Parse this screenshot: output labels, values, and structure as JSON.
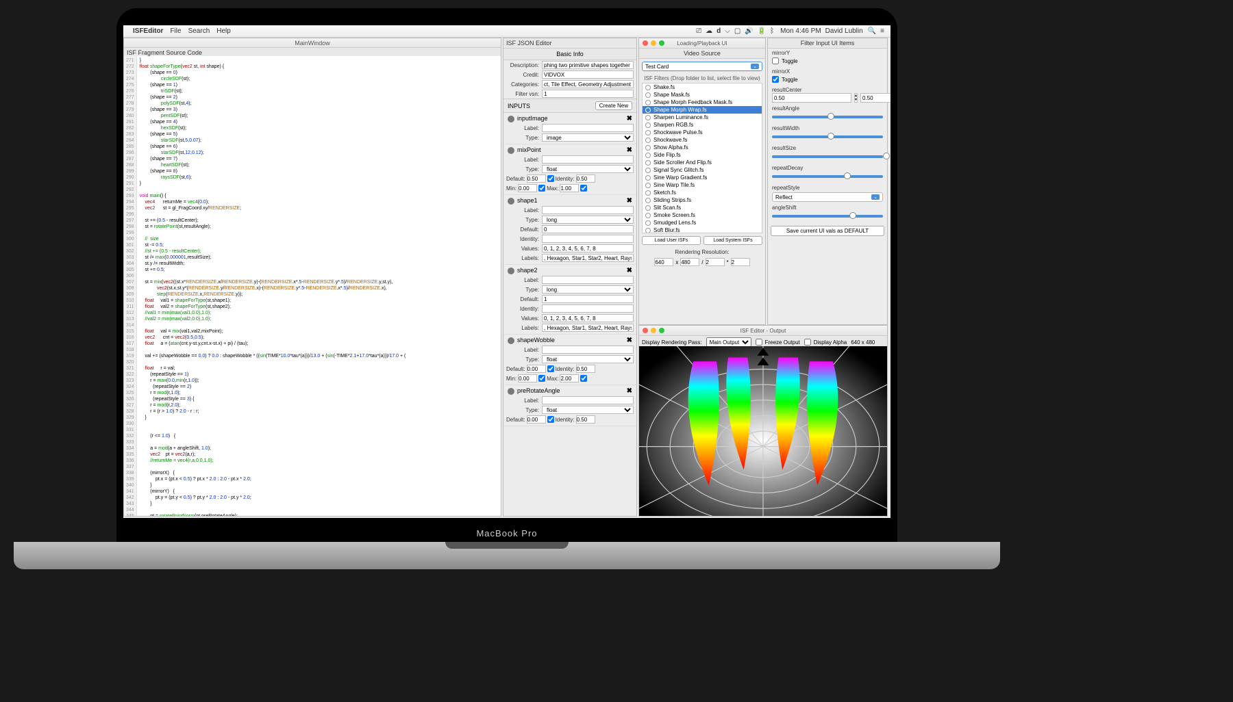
{
  "menubar": {
    "app": "ISFEditor",
    "menus": [
      "File",
      "Search",
      "Help"
    ],
    "clock": "Mon 4:46 PM",
    "user": "David Lublin"
  },
  "main_window": {
    "title": "MainWindow",
    "fragment_header": "ISF Fragment Source Code",
    "code_first_line": 271
  },
  "json_editor": {
    "title": "ISF JSON Editor",
    "basic_info": "Basic Info",
    "description_label": "Description:",
    "description_value": "phing two primitive shapes together",
    "credit_label": "Credit:",
    "credit_value": "VIDVOX",
    "categories_label": "Categories:",
    "categories_value": "ct, Tile Effect, Geometry Adjustment",
    "filter_vsn_label": "Filter vsn:",
    "filter_vsn_value": "1",
    "inputs_label": "INPUTS",
    "create_new": "Create New",
    "inputs": [
      {
        "name": "inputImage",
        "type": "image",
        "label": ""
      },
      {
        "name": "mixPoint",
        "type": "float",
        "label": "",
        "default": "0.50",
        "identity": "0.50",
        "min": "0.00",
        "max": "1.00"
      },
      {
        "name": "shape1",
        "type": "long",
        "label": "",
        "default": "0",
        "identity": "",
        "values": "0, 1, 2, 3, 4, 5, 6, 7, 8",
        "labels": ", Hexagon, Star1, Star2, Heart, Rays"
      },
      {
        "name": "shape2",
        "type": "long",
        "label": "",
        "default": "1",
        "identity": "",
        "values": "0, 1, 2, 3, 4, 5, 6, 7, 8",
        "labels": ", Hexagon, Star1, Star2, Heart, Rays"
      },
      {
        "name": "shapeWobble",
        "type": "float",
        "label": "",
        "default": "0.00",
        "identity": "0.50",
        "min": "0.00",
        "max": "2.00"
      },
      {
        "name": "preRotateAngle",
        "type": "float",
        "label": "",
        "default": "0.00",
        "identity": "0.50"
      }
    ],
    "field_labels": {
      "label": "Label:",
      "type": "Type:",
      "default": "Default:",
      "identity": "Identity:",
      "min": "Min:",
      "max": "Max:",
      "values": "Values:",
      "labels": "Labels:"
    }
  },
  "video_source": {
    "window_title": "Loading/Playback UI",
    "tab1": "Video Source",
    "tab2": "Filter Input UI Items",
    "dropdown": "Test Card",
    "hint": "ISF Filters (Drop folder to list, select file to view)",
    "filters": [
      "Shake.fs",
      "Shape Mask.fs",
      "Shape Morph Feedback Mask.fs",
      "Shape Morph Wrap.fs",
      "Sharpen Luminance.fs",
      "Sharpen RGB.fs",
      "Shockwave Pulse.fs",
      "Shockwave.fs",
      "Show Alpha.fs",
      "Side Flip.fs",
      "Side Scroller And Flip.fs",
      "Signal Sync Glitch.fs",
      "Sine Warp Gradient.fs",
      "Sine Warp Tile.fs",
      "Sketch.fs",
      "Sliding Strips.fs",
      "Slit Scan.fs",
      "Smoke Screen.fs",
      "Smudged Lens.fs",
      "Soft Blur.fs"
    ],
    "selected_filter": "Shape Morph Wrap.fs",
    "load_user": "Load User ISFs",
    "load_system": "Load System ISFs",
    "res_label": "Rendering Resolution:",
    "res_w": "640",
    "res_h": "480",
    "res_div": "2",
    "res_mul": "2"
  },
  "filter_ui": {
    "params": [
      {
        "name": "mirrorY",
        "type": "toggle",
        "checked": false,
        "label": "Toggle"
      },
      {
        "name": "mirrorX",
        "type": "toggle",
        "checked": true,
        "label": "Toggle"
      },
      {
        "name": "resultCenter",
        "type": "point2d",
        "x": "0.50",
        "y": "0.50"
      },
      {
        "name": "resultAngle",
        "type": "slider",
        "pos": 50
      },
      {
        "name": "resultWidth",
        "type": "slider",
        "pos": 50
      },
      {
        "name": "resultSize",
        "type": "slider",
        "pos": 100
      },
      {
        "name": "repeatDecay",
        "type": "slider",
        "pos": 65
      },
      {
        "name": "repeatStyle",
        "type": "select",
        "value": "Reflect"
      },
      {
        "name": "angleShift",
        "type": "slider",
        "pos": 70
      }
    ],
    "save_button": "Save current UI vals as DEFAULT"
  },
  "output": {
    "title": "ISF Editor - Output",
    "pass_label": "Display Rendering Pass:",
    "pass_value": "Main Output",
    "freeze": "Freeze Output",
    "alpha": "Display Alpha",
    "dims": "640 x 480"
  },
  "laptop_label": "MacBook Pro"
}
